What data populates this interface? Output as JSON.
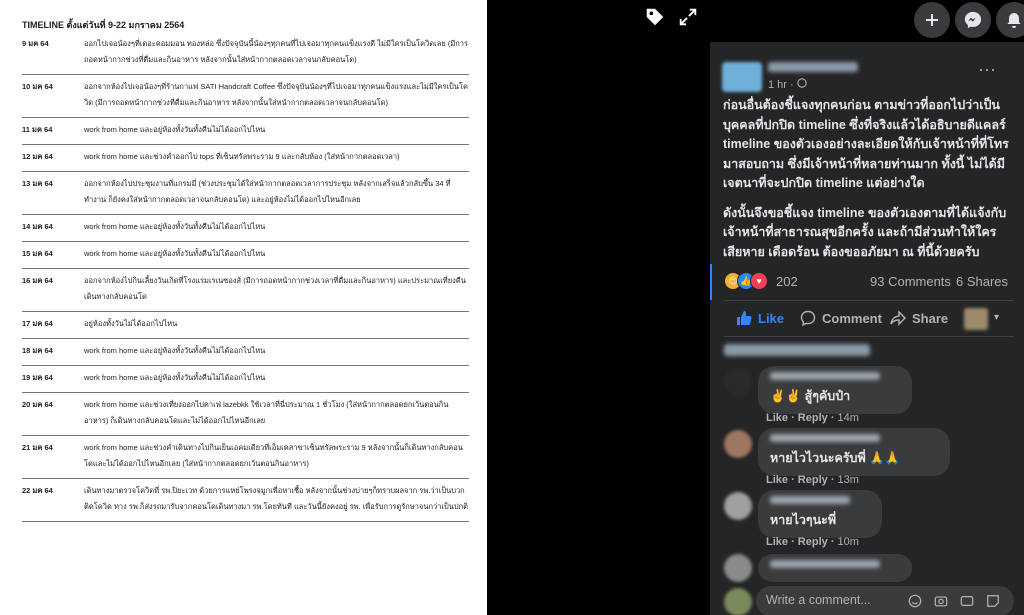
{
  "doc": {
    "title": "TIMELINE ตั้งแต่วันที่ 9-22 มกราคม 2564",
    "rows": [
      {
        "date": "9 มค 64",
        "text": "ออกไปเจอน้องๆที่เดอะคอมมอน ทองหล่อ ซึ่งปัจจุบันนี้น้องๆทุกคนที่ไปเจอมาทุกคนแข็งแรงดี ไม่มีใครเป็นโควิดเลย (มีการถอดหน้ากากช่วงที่ดื่มและกินอาหาร หลังจากนั้นใส่หน้ากากตลอดเวลาจนกลับคอนโด)"
      },
      {
        "date": "10 มค 64",
        "text": "ออกจากห้องไปเจอน้องๆที่ร้านกาแฟ SATI Handcraft Coffee ซึ่งปัจจุบันน้องๆที่ไปเจอมาทุกคนแข็งแรงและไม่มีใครเป็นโควิด (มีการถอดหน้ากากช่วงที่ดื่มและกินอาหาร หลังจากนั้นใส่หน้ากากตลอดเวลาจนกลับคอนโด)"
      },
      {
        "date": "11 มค 64",
        "text": "work from home และอยู่ห้องทั้งวันทั้งคืนไม่ได้ออกไปไหน"
      },
      {
        "date": "12 มค 64",
        "text": "work from home และช่วงค่ำออกไป tops ที่เซ็นทรัลพระราม 9 และกลับห้อง (ใส่หน้ากากตลอดเวลา)"
      },
      {
        "date": "13 มค 64",
        "text": "ออกจากห้องไปประชุมงานที่แกรมมี่ (ช่วงประชุมได้ใส่หน้ากากตลอดเวลาการประชุม หลังจากเสร็จแล้วกลับขึ้น 34 ที่ทำงาน ก็ยังคงใส่หน้ากากตลอดเวลาจนกลับคอนโด) และอยู่ห้องไม่ได้ออกไปไหนอีกเลย"
      },
      {
        "date": "14 มค 64",
        "text": "work from home และอยู่ห้องทั้งวันทั้งคืนไม่ได้ออกไปไหน"
      },
      {
        "date": "15 มค 64",
        "text": "work from home และอยู่ห้องทั้งวันทั้งคืนไม่ได้ออกไปไหน"
      },
      {
        "date": "16 มค 64",
        "text": "ออกจากห้องไปกินเลี้ยงวันเกิดที่โรงแรมเรเนซองส์ (มีการถอดหน้ากากช่วงเวลาที่ดื่มและกินอาหาร) และประมาณเที่ยงคืนเดินทางกลับคอนโด"
      },
      {
        "date": "17 มค 64",
        "text": "อยู่ห้องทั้งวันไม่ได้ออกไปไหน"
      },
      {
        "date": "18 มค 64",
        "text": "work from home และอยู่ห้องทั้งวันทั้งคืนไม่ได้ออกไปไหน"
      },
      {
        "date": "19 มค 64",
        "text": "work from home และอยู่ห้องทั้งวันทั้งคืนไม่ได้ออกไปไหน"
      },
      {
        "date": "20 มค 64",
        "text": "work from home และช่วงเที่ยงออกไปคาเฟ่ lazebkk ใช้เวลาที่นี่ประมาณ 1 ชั่วโมง (ใส่หน้ากากตลอดยกเว้นตอนกินอาหาร) ก็เดินทางกลับคอนโดและไม่ได้ออกไปไหนอีกเลย"
      },
      {
        "date": "21 มค 64",
        "text": "work from home และช่วงค่ำเดินทางไปกินเย็นเอคมเดียวที่เอ็มเคสาขาเซ็นทรัลพระราม 9 หลังจากนั้นก็เดินทางกลับคอนโดและไม่ได้ออกไปไหนอีกเลย (ใส่หน้ากากตลอดยกเว้นตอนกินอาหาร)"
      },
      {
        "date": "22 มค 64",
        "text": "เดินทางมาตรวจโควิดที่ รพ.ปิยะเวท ด้วยการแหย่โพรงจมูกเพื่อหาเชื้อ หลังจากนั้นช่วงบ่ายๆก็ทราบผลจาก รพ.ว่าเป็นบวกติดโควิด ทาง รพ.ก็ส่งรถมารับจากคอนโดเดินทางมา รพ.โดยทันที และวันนี้ยังคงอยู่ รพ. เพื่อรับการดูรักษาจนกว่าเป็นปกติ"
      }
    ]
  },
  "post": {
    "time": "1 hr ·",
    "paragraph1": "ก่อนอื่นต้องชี้แจงทุกคนก่อน ตามข่าวที่ออกไปว่าเป็นบุคคลที่ปกปิด timeline ซึ่งที่จริงแล้วได้อธิบายดีแคลร์ timeline ของตัวเองอย่างละเอียดให้กับเจ้าหน้าที่ที่โทรมาสอบถาม ซึ่งมีเจ้าหน้าที่หลายท่านมาก ทั้งนี้ ไม่ได้มีเจตนาที่จะปกปิด timeline แต่อย่างใด",
    "paragraph2": "ดังนั้นจึงขอชี้แจง timeline ของตัวเองตามที่ได้แจ้งกับเจ้าหน้าที่สาธารณสุขอีกครั้ง และถ้ามีส่วนทำให้ใครเสียหาย เดือดร้อน ต้องขออภัยมา ณ ที่นี้ด้วยครับ",
    "reaction_count": "202",
    "comments_count": "93 Comments",
    "shares_count": "6 Shares",
    "like_label": "Like",
    "comment_label": "Comment",
    "share_label": "Share"
  },
  "comments": [
    {
      "text": "✌️✌️ สู้ๆคับป๋า",
      "like": "Like",
      "reply": "Reply",
      "time": "14m"
    },
    {
      "text": "หายไวไวนะครับพี่ 🙏🙏",
      "like": "Like",
      "reply": "Reply",
      "time": "13m"
    },
    {
      "text": "หายไวๆนะพี่",
      "like": "Like",
      "reply": "Reply",
      "time": "10m"
    }
  ],
  "composer": {
    "placeholder": "Write a comment..."
  },
  "colors": {
    "panel_bg": "#242526",
    "like_blue": "#2d88ff",
    "bubble_bg": "#3a3b3c"
  }
}
